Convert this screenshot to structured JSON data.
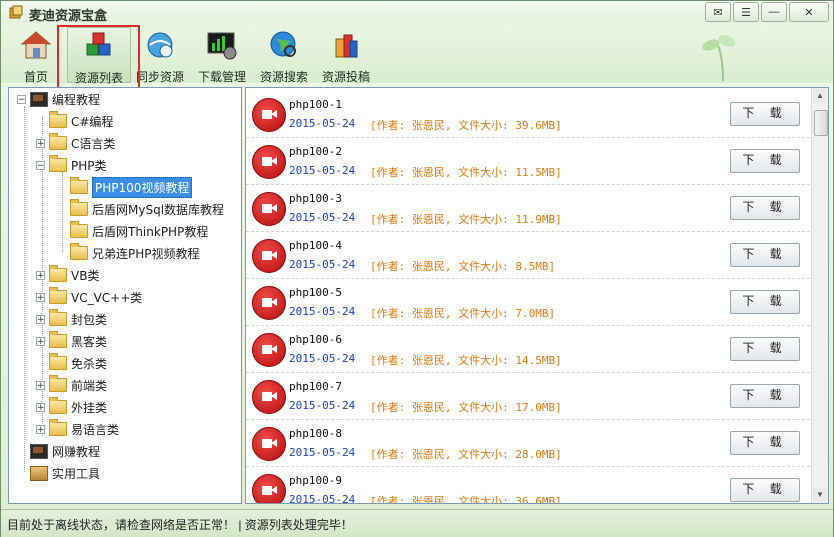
{
  "window": {
    "title": "麦迪资源宝盒"
  },
  "toolbar": {
    "items": [
      {
        "label": "首页",
        "icon": "home-icon"
      },
      {
        "label": "资源列表",
        "icon": "cubes-icon"
      },
      {
        "label": "同步资源",
        "icon": "sync-globe-icon"
      },
      {
        "label": "下载管理",
        "icon": "download-manager-icon"
      },
      {
        "label": "资源搜索",
        "icon": "globe-search-icon"
      },
      {
        "label": "资源投稿",
        "icon": "submit-icon"
      }
    ],
    "active_index": 1
  },
  "tree": {
    "nodes": [
      {
        "label": "编程教程"
      },
      {
        "label": "C#编程"
      },
      {
        "label": "C语言类"
      },
      {
        "label": "PHP类"
      },
      {
        "label": "PHP100视频教程"
      },
      {
        "label": "后盾网MySql数据库教程"
      },
      {
        "label": "后盾网ThinkPHP教程"
      },
      {
        "label": "兄弟连PHP视频教程"
      },
      {
        "label": "VB类"
      },
      {
        "label": "VC_VC++类"
      },
      {
        "label": "封包类"
      },
      {
        "label": "黑客类"
      },
      {
        "label": "免杀类"
      },
      {
        "label": "前端类"
      },
      {
        "label": "外挂类"
      },
      {
        "label": "易语言类"
      },
      {
        "label": "网赚教程"
      },
      {
        "label": "实用工具"
      }
    ],
    "selected": "PHP100视频教程"
  },
  "list": {
    "download_label": "下 载",
    "items": [
      {
        "name": "php100-1",
        "date": "2015-05-24",
        "meta": "[作者: 张恩民, 文件大小: 39.6MB]"
      },
      {
        "name": "php100-2",
        "date": "2015-05-24",
        "meta": "[作者: 张恩民, 文件大小: 11.5MB]"
      },
      {
        "name": "php100-3",
        "date": "2015-05-24",
        "meta": "[作者: 张恩民, 文件大小: 11.9MB]"
      },
      {
        "name": "php100-4",
        "date": "2015-05-24",
        "meta": "[作者: 张恩民, 文件大小: 8.5MB]"
      },
      {
        "name": "php100-5",
        "date": "2015-05-24",
        "meta": "[作者: 张恩民, 文件大小: 7.0MB]"
      },
      {
        "name": "php100-6",
        "date": "2015-05-24",
        "meta": "[作者: 张恩民, 文件大小: 14.5MB]"
      },
      {
        "name": "php100-7",
        "date": "2015-05-24",
        "meta": "[作者: 张恩民, 文件大小: 17.0MB]"
      },
      {
        "name": "php100-8",
        "date": "2015-05-24",
        "meta": "[作者: 张恩民, 文件大小: 28.0MB]"
      },
      {
        "name": "php100-9",
        "date": "2015-05-24",
        "meta": "[作者: 张恩民, 文件大小: 36.6MB]"
      }
    ]
  },
  "status": {
    "text": "目前处于离线状态，请检查网络是否正常！   |   资源列表处理完毕！"
  },
  "colors": {
    "date": "#1b44c6",
    "meta": "#e07b12",
    "highlight_box": "#e02a2a",
    "selection": "#3a8ee6"
  }
}
